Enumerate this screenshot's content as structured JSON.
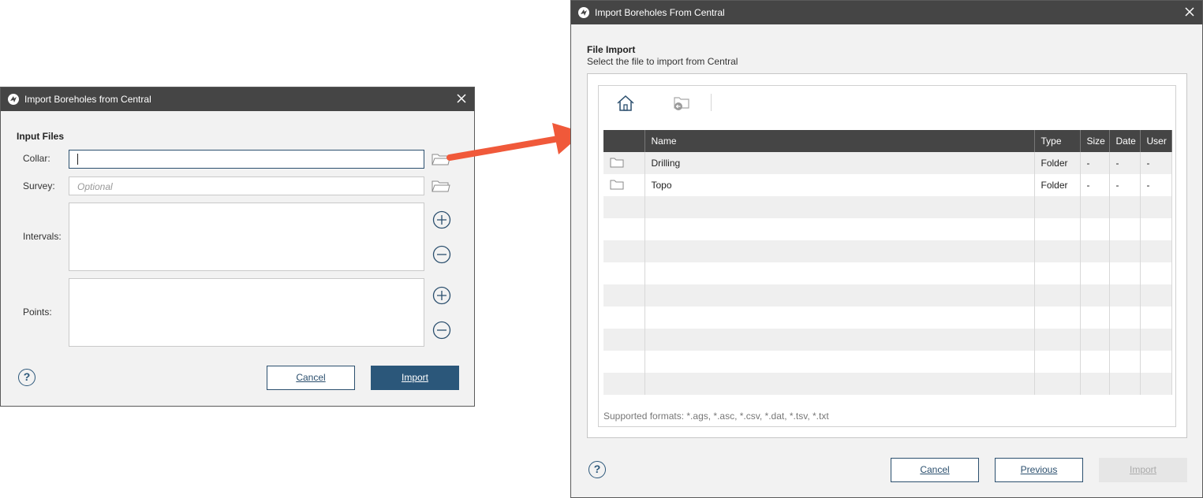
{
  "left_dialog": {
    "title": "Import Boreholes from Central",
    "section_label": "Input Files",
    "collar_label": "Collar:",
    "collar_value": "",
    "survey_label": "Survey:",
    "survey_placeholder": "Optional",
    "intervals_label": "Intervals:",
    "points_label": "Points:",
    "help_label": "?",
    "cancel_label": "Cancel",
    "import_label": "Import"
  },
  "right_dialog": {
    "title": "Import Boreholes From Central",
    "section_label": "File Import",
    "section_hint": "Select the file to import from Central",
    "columns": [
      "Name",
      "Type",
      "Size",
      "Date",
      "User"
    ],
    "rows": [
      {
        "name": "Drilling",
        "type": "Folder",
        "size": "-",
        "date": "-",
        "user": "-"
      },
      {
        "name": "Topo",
        "type": "Folder",
        "size": "-",
        "date": "-",
        "user": "-"
      }
    ],
    "supported_formats": "Supported formats: *.ags, *.asc, *.csv, *.dat, *.tsv, *.txt",
    "help_label": "?",
    "cancel_label": "Cancel",
    "previous_label": "Previous",
    "import_label": "Import"
  },
  "colors": {
    "titlebar": "#454545",
    "primary_button": "#2b577a",
    "arrow": "#f0593a"
  }
}
